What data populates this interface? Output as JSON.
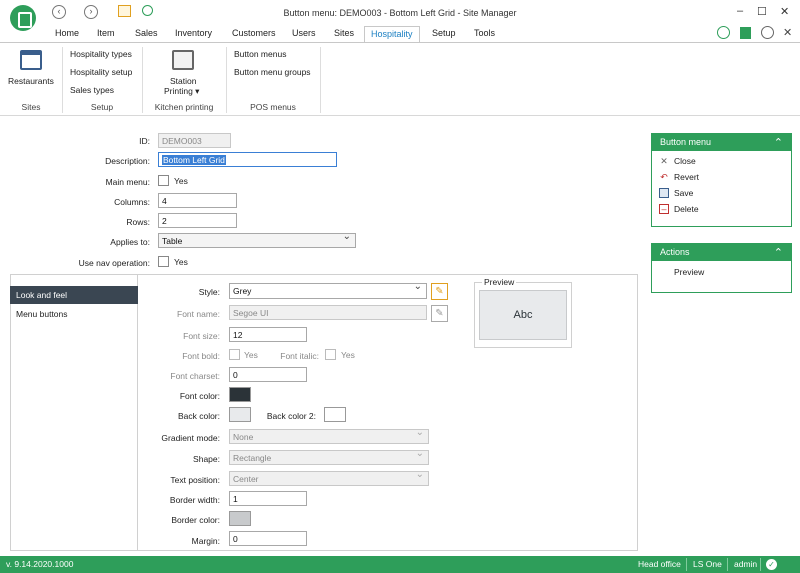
{
  "window": {
    "title": "Button menu: DEMO003 - Bottom Left Grid - Site Manager"
  },
  "menu_tabs": [
    "Home",
    "Item",
    "Sales",
    "Inventory",
    "Customers",
    "Users",
    "Sites",
    "Hospitality",
    "Setup",
    "Tools"
  ],
  "active_tab": "Hospitality",
  "ribbon": {
    "restaurants": "Restaurants",
    "hospitality_types": "Hospitality types",
    "hospitality_setup": "Hospitality setup",
    "sales_types": "Sales types",
    "station_printing_1": "Station",
    "station_printing_2": "Printing ▾",
    "button_menus": "Button menus",
    "button_menu_groups": "Button menu groups",
    "groups": [
      "Sites",
      "Setup",
      "Kitchen printing",
      "POS menus"
    ]
  },
  "form": {
    "id_label": "ID:",
    "id_value": "DEMO003",
    "description_label": "Description:",
    "description_value": "Bottom Left Grid",
    "main_menu_label": "Main menu:",
    "yes": "Yes",
    "columns_label": "Columns:",
    "columns_value": "4",
    "rows_label": "Rows:",
    "rows_value": "2",
    "applies_to_label": "Applies to:",
    "applies_to_value": "Table",
    "use_nav_label": "Use nav operation:"
  },
  "side_tabs": [
    "Look and feel",
    "Menu buttons"
  ],
  "look": {
    "style_label": "Style:",
    "style_value": "Grey",
    "font_name_label": "Font name:",
    "font_name_value": "Segoe UI",
    "font_size_label": "Font size:",
    "font_size_value": "12",
    "font_bold_label": "Font bold:",
    "font_italic_label": "Font italic:",
    "font_charset_label": "Font charset:",
    "font_charset_value": "0",
    "font_color_label": "Font color:",
    "back_color_label": "Back color:",
    "back_color2_label": "Back color 2:",
    "gradient_label": "Gradient mode:",
    "gradient_value": "None",
    "shape_label": "Shape:",
    "shape_value": "Rectangle",
    "text_pos_label": "Text position:",
    "text_pos_value": "Center",
    "border_width_label": "Border width:",
    "border_width_value": "1",
    "border_color_label": "Border color:",
    "margin_label": "Margin:",
    "margin_value": "0",
    "preview_label": "Preview",
    "preview_text": "Abc"
  },
  "colors": {
    "brand": "#2e9e5a",
    "font_color": "#2b3338",
    "back_color": "#e8eaec",
    "back_color2": "#ffffff",
    "border_color": "#c8cacc"
  },
  "button_menu_pane": {
    "title": "Button menu",
    "items": [
      "Close",
      "Revert",
      "Save",
      "Delete"
    ]
  },
  "actions_pane": {
    "title": "Actions",
    "items": [
      "Preview"
    ]
  },
  "status": {
    "version": "v. 9.14.2020.1000",
    "office": "Head office",
    "product": "LS One",
    "user": "admin"
  }
}
